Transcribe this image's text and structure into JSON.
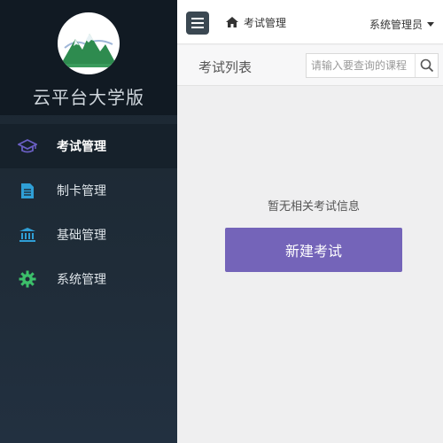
{
  "sidebar": {
    "brand_name": "云平台大学版",
    "items": [
      {
        "label": "考试管理",
        "icon": "graduation-cap-icon",
        "active": true,
        "color": "#6a5fc4"
      },
      {
        "label": "制卡管理",
        "icon": "document-icon",
        "active": false,
        "color": "#2f9fd6"
      },
      {
        "label": "基础管理",
        "icon": "bank-icon",
        "active": false,
        "color": "#2f9fd6"
      },
      {
        "label": "系统管理",
        "icon": "gear-icon",
        "active": false,
        "color": "#3cc06a"
      }
    ]
  },
  "topbar": {
    "breadcrumb": "考试管理",
    "user": "系统管理员"
  },
  "list": {
    "title": "考试列表",
    "search_placeholder": "请输入要查询的课程"
  },
  "content": {
    "empty_message": "暂无相关考试信息",
    "new_button": "新建考试"
  },
  "colors": {
    "accent": "#7464b9",
    "sidebar_bg": "#1f2c38"
  }
}
